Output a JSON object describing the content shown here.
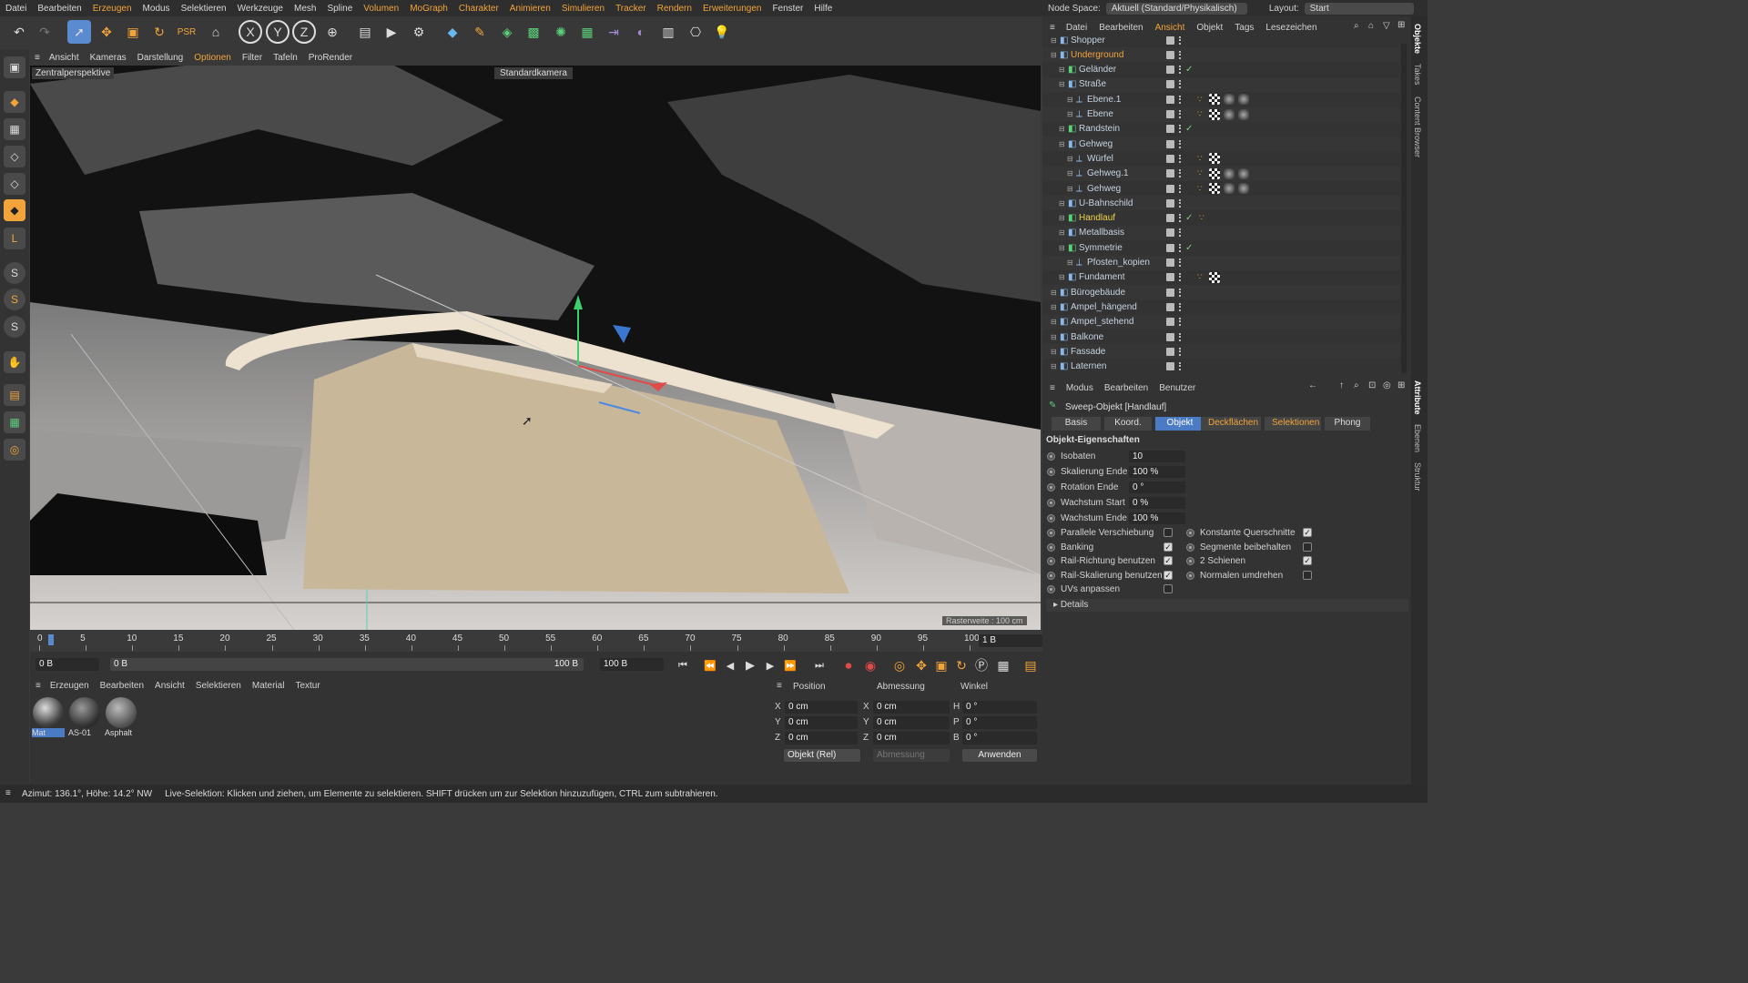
{
  "menu": [
    "Datei",
    "Bearbeiten",
    "Erzeugen",
    "Modus",
    "Selektieren",
    "Werkzeuge",
    "Mesh",
    "Spline",
    "Volumen",
    "MoGraph",
    "Charakter",
    "Animieren",
    "Simulieren",
    "Tracker",
    "Rendern",
    "Erweiterungen",
    "Fenster",
    "Hilfe"
  ],
  "node_space": {
    "label": "Node Space:",
    "value": "Aktuell (Standard/Physikalisch)",
    "layout_label": "Layout:",
    "layout_value": "Start"
  },
  "viewport_menu": [
    "Ansicht",
    "Kameras",
    "Darstellung",
    "Optionen",
    "Filter",
    "Tafeln",
    "ProRender"
  ],
  "viewport": {
    "view_name": "Zentralperspektive",
    "camera": "Standardkamera",
    "grid": "Rasterweite : 100 cm"
  },
  "timeline": {
    "ticks": [
      "0",
      "5",
      "10",
      "15",
      "20",
      "25",
      "30",
      "35",
      "40",
      "45",
      "50",
      "55",
      "60",
      "65",
      "70",
      "75",
      "80",
      "85",
      "90",
      "95",
      "100"
    ],
    "current": "1 B"
  },
  "transport": {
    "start": "0 B",
    "range_start": "0 B",
    "range_end": "100 B",
    "end": "100 B"
  },
  "material_menu": [
    "Erzeugen",
    "Bearbeiten",
    "Ansicht",
    "Selektieren",
    "Material",
    "Textur"
  ],
  "materials": [
    "Mat",
    "AS-01",
    "Asphalt"
  ],
  "coords": {
    "headers": [
      "Position",
      "Abmessung",
      "Winkel"
    ],
    "rows": [
      {
        "axis": "X",
        "pos": "0 cm",
        "axis2": "X",
        "size": "0 cm",
        "axis3": "H",
        "rot": "0 °"
      },
      {
        "axis": "Y",
        "pos": "0 cm",
        "axis2": "Y",
        "size": "0 cm",
        "axis3": "P",
        "rot": "0 °"
      },
      {
        "axis": "Z",
        "pos": "0 cm",
        "axis2": "Z",
        "size": "0 cm",
        "axis3": "B",
        "rot": "0 °"
      }
    ],
    "mode": "Objekt (Rel)",
    "size_mode": "Abmessung",
    "apply": "Anwenden"
  },
  "status": {
    "azimuth": "Azimut: 136.1°, Höhe: 14.2°  NW",
    "message": "Live-Selektion: Klicken und ziehen, um Elemente zu selektieren. SHIFT drücken um zur Selektion hinzuzufügen, CTRL zum subtrahieren."
  },
  "object_manager": {
    "menu": [
      "Datei",
      "Bearbeiten",
      "Ansicht",
      "Objekt",
      "Tags",
      "Lesezeichen"
    ],
    "objects": [
      {
        "name": "Shopper",
        "indent": 1,
        "style": ""
      },
      {
        "name": "Underground",
        "indent": 1,
        "style": "o"
      },
      {
        "name": "Geländer",
        "indent": 2,
        "style": "",
        "check": true
      },
      {
        "name": "Straße",
        "indent": 2,
        "style": ""
      },
      {
        "name": "Ebene.1",
        "indent": 3,
        "style": "",
        "tags": 3
      },
      {
        "name": "Ebene",
        "indent": 3,
        "style": "",
        "tags": 3
      },
      {
        "name": "Randstein",
        "indent": 2,
        "style": "",
        "check": true
      },
      {
        "name": "Gehweg",
        "indent": 2,
        "style": ""
      },
      {
        "name": "Würfel",
        "indent": 3,
        "style": "",
        "tags": 1
      },
      {
        "name": "Gehweg.1",
        "indent": 3,
        "style": "",
        "tags": 3
      },
      {
        "name": "Gehweg",
        "indent": 3,
        "style": "",
        "tags": 3
      },
      {
        "name": "U-Bahnschild",
        "indent": 2,
        "style": ""
      },
      {
        "name": "Handlauf",
        "indent": 2,
        "style": "y",
        "check": true,
        "tags": 0
      },
      {
        "name": "Metallbasis",
        "indent": 2,
        "style": ""
      },
      {
        "name": "Symmetrie",
        "indent": 2,
        "style": "",
        "check": true
      },
      {
        "name": "Pfosten_kopien",
        "indent": 3,
        "style": ""
      },
      {
        "name": "Fundament",
        "indent": 2,
        "style": "",
        "tags": 1
      },
      {
        "name": "Bürogebäude",
        "indent": 1,
        "style": ""
      },
      {
        "name": "Ampel_hängend",
        "indent": 1,
        "style": ""
      },
      {
        "name": "Ampel_stehend",
        "indent": 1,
        "style": ""
      },
      {
        "name": "Balkone",
        "indent": 1,
        "style": ""
      },
      {
        "name": "Fassade",
        "indent": 1,
        "style": ""
      },
      {
        "name": "Laternen",
        "indent": 1,
        "style": ""
      }
    ]
  },
  "attributes": {
    "menu": [
      "Modus",
      "Bearbeiten",
      "Benutzer"
    ],
    "title": "Sweep-Objekt [Handlauf]",
    "tabs": [
      "Basis",
      "Koord.",
      "Objekt",
      "Deckflächen",
      "Selektionen",
      "Phong"
    ],
    "section": "Objekt-Eigenschaften",
    "fields": [
      {
        "label": "Isobaten",
        "value": "10"
      },
      {
        "label": "Skalierung Ende",
        "value": "100 %"
      },
      {
        "label": "Rotation Ende",
        "value": "0 °"
      },
      {
        "label": "Wachstum Start",
        "value": "0 %"
      },
      {
        "label": "Wachstum Ende",
        "value": "100 %"
      }
    ],
    "checks_left": [
      {
        "label": "Parallele Verschiebung",
        "on": false
      },
      {
        "label": "Banking",
        "on": true
      },
      {
        "label": "Rail-Richtung benutzen",
        "on": true
      },
      {
        "label": "Rail-Skalierung benutzen",
        "on": true
      },
      {
        "label": "UVs anpassen",
        "on": false
      }
    ],
    "checks_right": [
      {
        "label": "Konstante Querschnitte",
        "on": true
      },
      {
        "label": "Segmente beibehalten",
        "on": false
      },
      {
        "label": "2 Schienen",
        "on": true
      },
      {
        "label": "Normalen umdrehen",
        "on": false
      }
    ],
    "details": "Details"
  },
  "side_tabs": [
    "Objekte",
    "Takes",
    "Content Browser",
    "Attribute",
    "Ebenen",
    "Struktur"
  ],
  "colors": {
    "accent": "#4b7bc4",
    "orange": "#f2a43a",
    "yellow": "#f0d34a",
    "surface": "#c9b79a"
  }
}
